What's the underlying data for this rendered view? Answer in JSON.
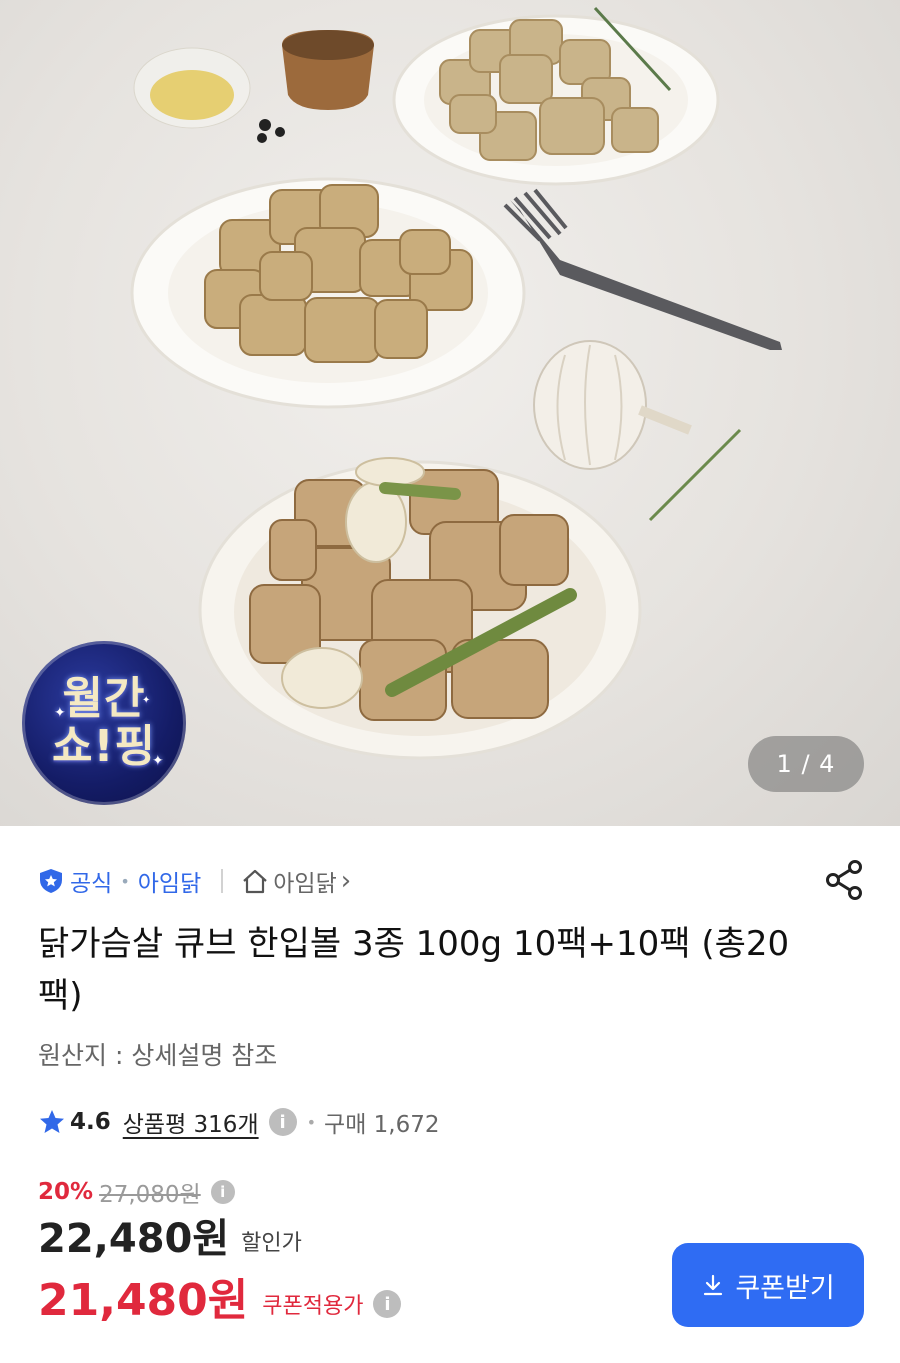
{
  "gallery": {
    "counter": "1 / 4",
    "badge_line1": "월간",
    "badge_line2": "쇼!핑"
  },
  "store": {
    "official_label": "공식",
    "seller_name": "아임닭",
    "store_link": "아임닭",
    "store_link_chevron": "›"
  },
  "product": {
    "title": "닭가슴살 큐브 한입볼 3종 100g 10팩+10팩 (총20팩)",
    "origin": "원산지 : 상세설명 참조"
  },
  "rating": {
    "score": "4.6",
    "review_label": "상품평 316개",
    "purchase_label": "구매 1,672"
  },
  "price": {
    "discount_rate": "20%",
    "original_price": "27,080원",
    "sale_price": "22,480원",
    "sale_price_tag": "할인가",
    "coupon_price": "21,480원",
    "coupon_price_tag": "쿠폰적용가",
    "coupon_button": "쿠폰받기"
  },
  "colors": {
    "accent_blue": "#2f6cf3",
    "discount_red": "#e0293d"
  },
  "icons": [
    "official-shield-icon",
    "home-icon",
    "share-icon",
    "star-icon",
    "info-icon",
    "download-icon"
  ]
}
